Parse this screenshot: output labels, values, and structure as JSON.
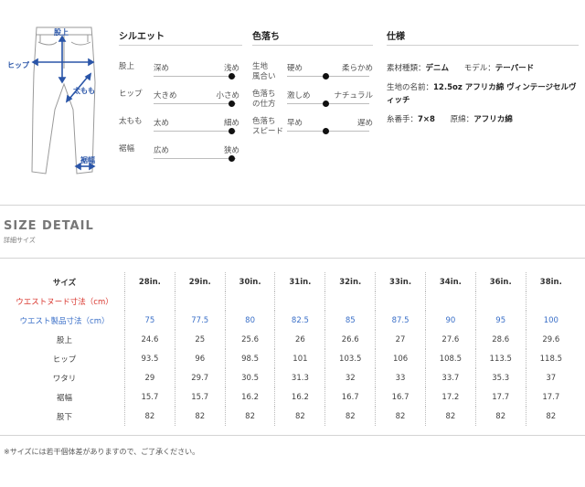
{
  "diagram": {
    "labels": {
      "rise": "股上",
      "hip": "ヒップ",
      "thigh": "太もも",
      "hem": "裾幅"
    },
    "accent": "#2a55a8"
  },
  "silhouette": {
    "title": "シルエット",
    "rows": [
      {
        "label": "股上",
        "left": "深め",
        "right": "浅め",
        "level": 0.95
      },
      {
        "label": "ヒップ",
        "left": "大きめ",
        "right": "小さめ",
        "level": 0.95
      },
      {
        "label": "太もも",
        "left": "太め",
        "right": "細め",
        "level": 0.95
      },
      {
        "label": "裾幅",
        "left": "広め",
        "right": "狭め",
        "level": 0.95
      }
    ]
  },
  "fading": {
    "title": "色落ち",
    "rows": [
      {
        "label": "生地\n風合い",
        "left": "硬め",
        "right": "柔らかめ",
        "level": 0.45
      },
      {
        "label": "色落ち\nの仕方",
        "left": "激しめ",
        "right": "ナチュラル",
        "level": 0.45
      },
      {
        "label": "色落ち\nスピード",
        "left": "早め",
        "right": "遅め",
        "level": 0.45
      }
    ]
  },
  "spec": {
    "title": "仕様",
    "material_label": "素材種類：",
    "material": "デニム",
    "model_label": "モデル：",
    "model": "テーパード",
    "fabric_label": "生地の名前：",
    "fabric": "12.5oz アフリカ綿 ヴィンテージセルヴィッチ",
    "thread_label": "糸番手：",
    "thread": "7×8",
    "cotton_label": "原綿：",
    "cotton": "アフリカ綿"
  },
  "size_detail": {
    "title": "SIZE DETAIL",
    "subtitle": "詳細サイズ",
    "header": {
      "label": "サイズ",
      "sizes": [
        "28in.",
        "29in.",
        "30in.",
        "31in.",
        "32in.",
        "33in.",
        "34in.",
        "36in.",
        "38in."
      ]
    },
    "rows": [
      {
        "label": "ウエストヌード寸法（cm）",
        "values": [
          "",
          "",
          "",
          "",
          "",
          "",
          "",
          "",
          ""
        ]
      },
      {
        "label": "ウエスト製品寸法（cm）",
        "values": [
          "75",
          "77.5",
          "80",
          "82.5",
          "85",
          "87.5",
          "90",
          "95",
          "100"
        ]
      },
      {
        "label": "股上",
        "values": [
          "24.6",
          "25",
          "25.6",
          "26",
          "26.6",
          "27",
          "27.6",
          "28.6",
          "29.6"
        ]
      },
      {
        "label": "ヒップ",
        "values": [
          "93.5",
          "96",
          "98.5",
          "101",
          "103.5",
          "106",
          "108.5",
          "113.5",
          "118.5"
        ]
      },
      {
        "label": "ワタリ",
        "values": [
          "29",
          "29.7",
          "30.5",
          "31.3",
          "32",
          "33",
          "33.7",
          "35.3",
          "37"
        ]
      },
      {
        "label": "裾幅",
        "values": [
          "15.7",
          "15.7",
          "16.2",
          "16.2",
          "16.7",
          "16.7",
          "17.2",
          "17.7",
          "17.7"
        ]
      },
      {
        "label": "股下",
        "values": [
          "82",
          "82",
          "82",
          "82",
          "82",
          "82",
          "82",
          "82",
          "82"
        ]
      }
    ],
    "note": "※サイズには若干個体差がありますので、ご了承ください。"
  },
  "colors": {
    "red": "#d9362e",
    "blue": "#3a6fc8",
    "dot": "#111111"
  }
}
